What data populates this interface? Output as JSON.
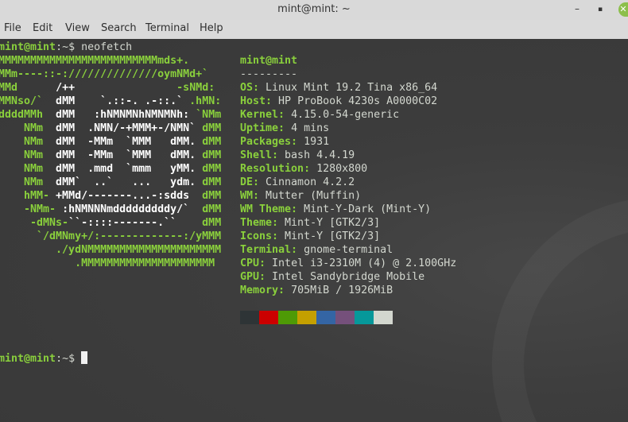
{
  "window": {
    "title": "mint@mint: ~",
    "minimize": "–",
    "maximize": "▪",
    "close": "✕"
  },
  "menu": [
    "File",
    "Edit",
    "View",
    "Search",
    "Terminal",
    "Help"
  ],
  "prompt": {
    "user_host": "mint@mint",
    "path_symbol": ":~$ ",
    "command": "neofetch"
  },
  "ascii_logo": [
    [
      [
        "MMMMMMMMMMMMMMMMMMMMMMMMMmds+.",
        "g"
      ]
    ],
    [
      [
        "MMm----::-://////////////oymNMd+`",
        "g"
      ]
    ],
    [
      [
        "MMd",
        "g"
      ],
      [
        "      /++",
        "w"
      ],
      [
        "                -sNMd:",
        "g"
      ]
    ],
    [
      [
        "MMNso/`",
        "g"
      ],
      [
        "  dMM    `.::-. .-::.`",
        "w"
      ],
      [
        " .hMN:",
        "g"
      ]
    ],
    [
      [
        "ddddMMh",
        "g"
      ],
      [
        "  dMM   :hNMNMNhNMNMNh:",
        "w"
      ],
      [
        " `NMm",
        "g"
      ]
    ],
    [
      [
        "    NMm",
        "g"
      ],
      [
        "  dMM  .NMN/-+MMM+-/NMN`",
        "w"
      ],
      [
        " dMM",
        "g"
      ]
    ],
    [
      [
        "    NMm",
        "g"
      ],
      [
        "  dMM  -MMm  `MMM   dMM.",
        "w"
      ],
      [
        " dMM",
        "g"
      ]
    ],
    [
      [
        "    NMm",
        "g"
      ],
      [
        "  dMM  -MMm  `MMM   dMM.",
        "w"
      ],
      [
        " dMM",
        "g"
      ]
    ],
    [
      [
        "    NMm",
        "g"
      ],
      [
        "  dMM  .mmd  `mmm   yMM.",
        "w"
      ],
      [
        " dMM",
        "g"
      ]
    ],
    [
      [
        "    NMm",
        "g"
      ],
      [
        "  dMM`  ..`   ...   ydm.",
        "w"
      ],
      [
        " dMM",
        "g"
      ]
    ],
    [
      [
        "    hMM-",
        "g"
      ],
      [
        " +MMd/-------...-:sdds",
        "w"
      ],
      [
        "  dMM",
        "g"
      ]
    ],
    [
      [
        "    -NMm-",
        "g"
      ],
      [
        " :hNMNNNmdddddddddy/`",
        "w"
      ],
      [
        "  dMM",
        "g"
      ]
    ],
    [
      [
        "     -dMNs-",
        "g"
      ],
      [
        "``-::::-------.``",
        "w"
      ],
      [
        "    dMM",
        "g"
      ]
    ],
    [
      [
        "      `/dMNmy+/:-------------:/yMMM",
        "g"
      ]
    ],
    [
      [
        "         ./ydNMMMMMMMMMMMMMMMMMMMMM",
        "g"
      ]
    ],
    [
      [
        "            .MMMMMMMMMMMMMMMMMMMMM",
        "g"
      ]
    ]
  ],
  "info": {
    "header": "mint@mint",
    "separator": "---------",
    "rows": [
      {
        "label": "OS",
        "value": "Linux Mint 19.2 Tina x86_64"
      },
      {
        "label": "Host",
        "value": "HP ProBook 4230s A0000C02"
      },
      {
        "label": "Kernel",
        "value": "4.15.0-54-generic"
      },
      {
        "label": "Uptime",
        "value": "4 mins"
      },
      {
        "label": "Packages",
        "value": "1931"
      },
      {
        "label": "Shell",
        "value": "bash 4.4.19"
      },
      {
        "label": "Resolution",
        "value": "1280x800"
      },
      {
        "label": "DE",
        "value": "Cinnamon 4.2.2"
      },
      {
        "label": "WM",
        "value": "Mutter (Muffin)"
      },
      {
        "label": "WM Theme",
        "value": "Mint-Y-Dark (Mint-Y)"
      },
      {
        "label": "Theme",
        "value": "Mint-Y [GTK2/3]"
      },
      {
        "label": "Icons",
        "value": "Mint-Y [GTK2/3]"
      },
      {
        "label": "Terminal",
        "value": "gnome-terminal"
      },
      {
        "label": "CPU",
        "value": "Intel i3-2310M (4) @ 2.100GHz"
      },
      {
        "label": "GPU",
        "value": "Intel Sandybridge Mobile"
      },
      {
        "label": "Memory",
        "value": "705MiB / 1926MiB"
      }
    ]
  },
  "palette": [
    "#2e3436",
    "#cc0000",
    "#4e9a06",
    "#c4a000",
    "#3465a4",
    "#75507b",
    "#06989a",
    "#d3d7cf"
  ]
}
